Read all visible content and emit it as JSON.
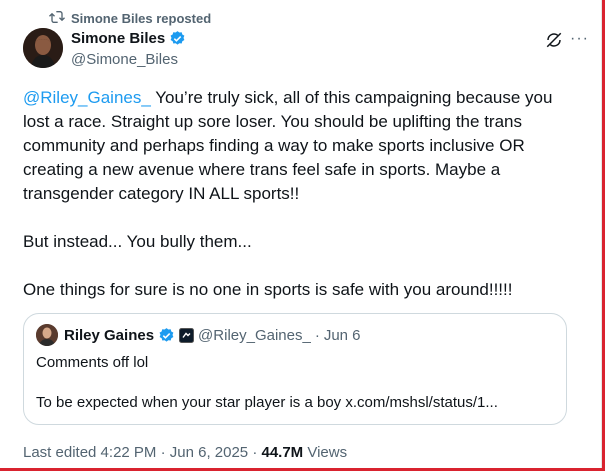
{
  "repost": {
    "label": "Simone Biles reposted",
    "icon": "repost-icon"
  },
  "author": {
    "name": "Simone Biles",
    "handle": "@Simone_Biles",
    "verified_icon": "verified-badge-icon"
  },
  "header_actions": {
    "grok_icon": "grok-icon",
    "more_label": "···"
  },
  "tweet": {
    "mention": "@Riley_Gaines_",
    "body": " You’re truly sick, all of this campaigning because you lost a race. Straight up sore loser. You should be uplifting the trans community and perhaps finding a way to make sports inclusive OR creating a new avenue where trans feel safe in sports. Maybe a transgender category IN ALL sports!!\n\nBut instead... You bully them...\n\nOne things for sure is no one in sports is safe with you around!!!!!"
  },
  "quote": {
    "name": "Riley Gaines",
    "handle": "@Riley_Gaines_",
    "separator": "·",
    "date": "Jun 6",
    "line1": "Comments off lol",
    "line2": "To be expected when your star player is a boy x.com/mshsl/status/1..."
  },
  "meta": {
    "edited": "Last edited 4:22 PM · Jun 6, 2025 ·",
    "views_count": "44.7M",
    "views_label": "Views"
  },
  "colors": {
    "link": "#1d9bf0",
    "verified": "#1d9bf0",
    "muted": "#536471",
    "frame": "#d9232f"
  }
}
